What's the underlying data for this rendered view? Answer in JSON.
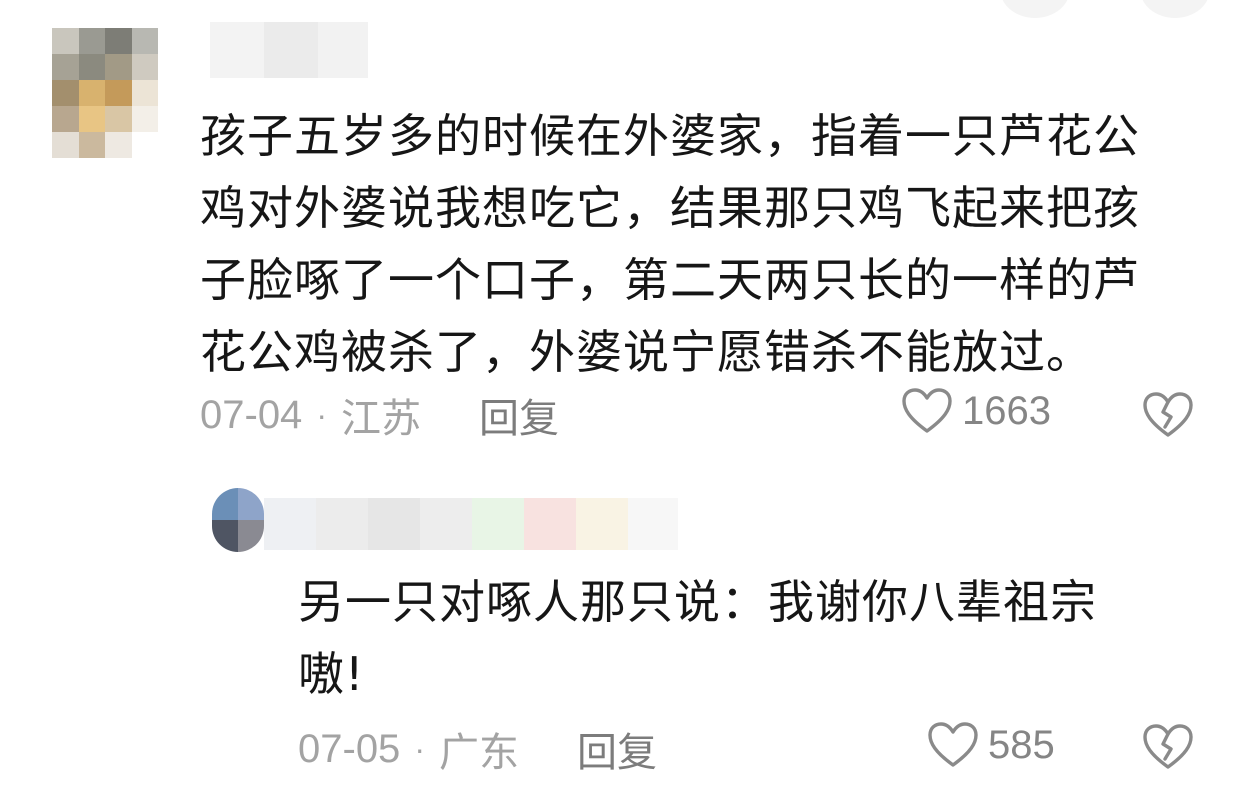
{
  "comments": [
    {
      "text": "孩子五岁多的时候在外婆家，指着一只芦花公\n鸡对外婆说我想吃它，结果那只鸡飞起来把孩\n子脸啄了一个口子，第二天两只长的一样的芦\n花公鸡被杀了，外婆说宁愿错杀不能放过。",
      "date": "07-04",
      "separator": "·",
      "location": "江苏",
      "reply_label": "回复",
      "like_count": "1663",
      "like_icon": "heart-outline-icon",
      "dislike_icon": "broken-heart-icon"
    },
    {
      "text": "另一只对啄人那只说：我谢你八辈祖宗\n嗷!",
      "date": "07-05",
      "separator": "·",
      "location": "广东",
      "reply_label": "回复",
      "like_count": "585",
      "like_icon": "heart-outline-icon",
      "dislike_icon": "broken-heart-icon"
    }
  ],
  "colors": {
    "text_primary": "#161616",
    "text_meta": "#a3a3a3",
    "reply": "#7c7c7c",
    "icon": "#8a8a8a"
  }
}
